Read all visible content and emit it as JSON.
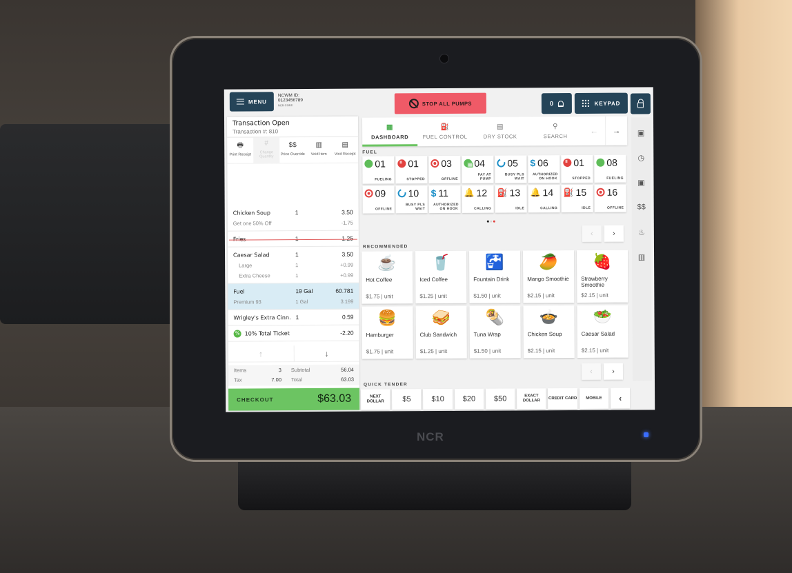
{
  "device": {
    "brand": "NCR"
  },
  "header": {
    "menu_label": "MENU",
    "ncwm_label": "NCWM ID:",
    "ncwm_id": "0123456789",
    "corp": "NCR CORP.",
    "stop_pumps_label": "STOP ALL PUMPS",
    "notification_count": "0",
    "keypad_label": "KEYPAD"
  },
  "transaction": {
    "title": "Transaction Open",
    "number": "Transaction #: 810",
    "actions": [
      {
        "label": "Print Receipt",
        "icon": "printer-icon",
        "disabled": false
      },
      {
        "label": "Change Quantity",
        "icon": "hash-icon",
        "disabled": true
      },
      {
        "label": "Price Override",
        "icon": "price-override-icon",
        "disabled": false
      },
      {
        "label": "Void Item",
        "icon": "void-item-icon",
        "disabled": false
      },
      {
        "label": "Void Receipt",
        "icon": "void-receipt-icon",
        "disabled": false
      }
    ],
    "items": [
      {
        "name": "Chicken Soup",
        "qty": "1",
        "price": "3.50",
        "sub": [
          {
            "name": "Get one 50% Off",
            "qty": "",
            "price": "-1.75"
          }
        ]
      },
      {
        "name": "Fries",
        "qty": "1",
        "price": "1.25",
        "voided": true
      },
      {
        "name": "Caesar Salad",
        "qty": "1",
        "price": "3.50",
        "mods": [
          {
            "name": "Large",
            "qty": "1",
            "price": "+0.99"
          },
          {
            "name": "Extra Cheese",
            "qty": "1",
            "price": "+0.99"
          }
        ]
      },
      {
        "name": "Fuel",
        "qty": "19 Gal",
        "price": "60.781",
        "selected": true,
        "sub": [
          {
            "name": "Premium 93",
            "qty": "1 Gal",
            "price": "3.199"
          }
        ]
      },
      {
        "name": "Wrigley's Extra Cinn.",
        "qty": "1",
        "price": "0.59"
      },
      {
        "name": "10% Total Ticket",
        "qty": "",
        "price": "-2.20",
        "discount": true
      }
    ],
    "totals": {
      "items_label": "Items",
      "items": "3",
      "subtotal_label": "Subtotal",
      "subtotal": "56.04",
      "tax_label": "Tax",
      "tax": "7.00",
      "total_label": "Total",
      "total": "63.03"
    },
    "checkout_label": "CHECKOUT",
    "checkout_amount": "$63.03"
  },
  "tabs": [
    {
      "label": "DASHBOARD",
      "icon": "dashboard-icon",
      "active": true
    },
    {
      "label": "FUEL CONTROL",
      "icon": "fuel-pump-icon",
      "active": false
    },
    {
      "label": "DRY STOCK",
      "icon": "store-icon",
      "active": false
    },
    {
      "label": "SEARCH",
      "icon": "search-icon",
      "active": false
    }
  ],
  "fuel": {
    "section_label": "FUEL",
    "page": 3,
    "pages": 3,
    "pumps": [
      {
        "num": "01",
        "status": "FUELING",
        "state": "fueling"
      },
      {
        "num": "01",
        "status": "STOPPED",
        "state": "stopped"
      },
      {
        "num": "03",
        "status": "OFFLINE",
        "state": "offline"
      },
      {
        "num": "04",
        "status": "PAY AT PUMP",
        "state": "pay"
      },
      {
        "num": "05",
        "status": "BUSY PLS WAIT",
        "state": "busy"
      },
      {
        "num": "06",
        "status": "AUTHORIZED ON HOOK",
        "state": "auth"
      },
      {
        "num": "01",
        "status": "STOPPED",
        "state": "stopped"
      },
      {
        "num": "08",
        "status": "FUELING",
        "state": "fueling"
      },
      {
        "num": "09",
        "status": "OFFLINE",
        "state": "offline"
      },
      {
        "num": "10",
        "status": "BUSY PLS WAIT",
        "state": "busy"
      },
      {
        "num": "11",
        "status": "AUTHORIZED ON HOOK",
        "state": "auth"
      },
      {
        "num": "12",
        "status": "CALLING",
        "state": "calling"
      },
      {
        "num": "13",
        "status": "IDLE",
        "state": "idle"
      },
      {
        "num": "14",
        "status": "CALLING",
        "state": "calling"
      },
      {
        "num": "15",
        "status": "IDLE",
        "state": "idle"
      },
      {
        "num": "16",
        "status": "OFFLINE",
        "state": "offline"
      }
    ]
  },
  "recommended": {
    "section_label": "RECOMMENDED",
    "products": [
      {
        "name": "Hot Coffee",
        "price": "$1.75 | unit",
        "icon": "☕"
      },
      {
        "name": "Iced Coffee",
        "price": "$1.25 | unit",
        "icon": "🥤"
      },
      {
        "name": "Fountain Drink",
        "price": "$1.50 | unit",
        "icon": "🚰"
      },
      {
        "name": "Mango Smoothie",
        "price": "$2.15 | unit",
        "icon": "🥭"
      },
      {
        "name": "Strawberry Smoothie",
        "price": "$2.15 | unit",
        "icon": "🍓"
      },
      {
        "name": "Hamburger",
        "price": "$1.75 | unit",
        "icon": "🍔"
      },
      {
        "name": "Club Sandwich",
        "price": "$1.25 | unit",
        "icon": "🥪"
      },
      {
        "name": "Tuna Wrap",
        "price": "$1.50 | unit",
        "icon": "🌯"
      },
      {
        "name": "Chicken Soup",
        "price": "$2.15 | unit",
        "icon": "🍲"
      },
      {
        "name": "Caesar Salad",
        "price": "$2.15 | unit",
        "icon": "🥗"
      }
    ]
  },
  "quick_tender": {
    "section_label": "QUICK TENDER",
    "buttons": [
      "NEXT DOLLAR",
      "$5",
      "$10",
      "$20",
      "$50",
      "EXACT DOLLAR",
      "CREDIT CARD",
      "MOBILE"
    ]
  },
  "sidebar": [
    "cash-drawer-icon",
    "clock-icon",
    "cash-drawer-icon",
    "coins-icon",
    "cake-icon",
    "no-barcode-icon"
  ],
  "colors": {
    "primary": "#254458",
    "accent_green": "#6cc462",
    "danger": "#ef5a67",
    "info": "#1e90c8",
    "warning": "#f2a21a"
  }
}
